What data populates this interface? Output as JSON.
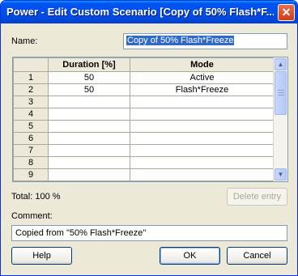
{
  "title": "Power - Edit Custom Scenario [Copy of 50% Flash*F...",
  "close_glyph": "✕",
  "name_label": "Name:",
  "name_value": "Copy of 50% Flash*Freeze",
  "grid": {
    "headers": [
      "Duration [%]",
      "Mode"
    ],
    "rows": [
      {
        "num": "1",
        "duration": "50",
        "mode": "Active"
      },
      {
        "num": "2",
        "duration": "50",
        "mode": "Flash*Freeze"
      },
      {
        "num": "3",
        "duration": "",
        "mode": ""
      },
      {
        "num": "4",
        "duration": "",
        "mode": ""
      },
      {
        "num": "5",
        "duration": "",
        "mode": ""
      },
      {
        "num": "6",
        "duration": "",
        "mode": ""
      },
      {
        "num": "7",
        "duration": "",
        "mode": ""
      },
      {
        "num": "8",
        "duration": "",
        "mode": ""
      },
      {
        "num": "9",
        "duration": "",
        "mode": ""
      }
    ]
  },
  "total_label": "Total: 100 %",
  "delete_entry_label": "Delete entry",
  "comment_label": "Comment:",
  "comment_value": "Copied from \"50% Flash*Freeze\"",
  "help_label": "Help",
  "ok_label": "OK",
  "cancel_label": "Cancel",
  "scroll_up_glyph": "▲",
  "scroll_down_glyph": "▼"
}
